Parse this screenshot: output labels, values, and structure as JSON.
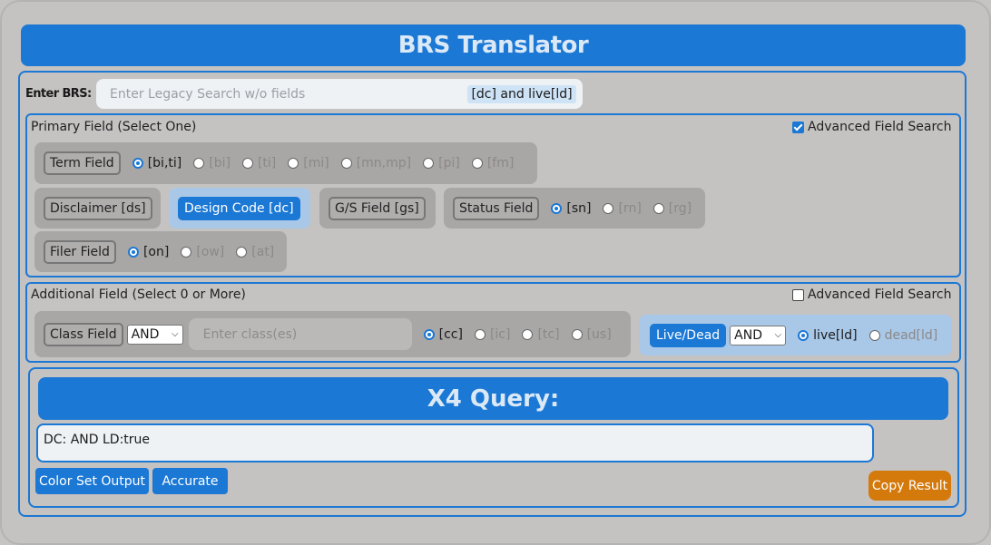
{
  "app": {
    "title": "BRS Translator"
  },
  "enter": {
    "label": "Enter BRS:",
    "placeholder": "Enter Legacy Search w/o fields",
    "value": "",
    "result": "[dc] and live[ld]"
  },
  "primary": {
    "title": "Primary Field (Select One)",
    "advanced_label": "Advanced Field Search",
    "advanced_checked": true,
    "term": {
      "label": "Term Field",
      "options": [
        "[bi,ti]",
        "[bi]",
        "[ti]",
        "[mi]",
        "[mn,mp]",
        "[pi]",
        "[fm]"
      ],
      "selected": "[bi,ti]"
    },
    "disclaimer": {
      "label": "Disclaimer [ds]"
    },
    "design_code": {
      "label": "Design Code [dc]",
      "active": true
    },
    "gs": {
      "label": "G/S Field [gs]"
    },
    "status": {
      "label": "Status Field",
      "options": [
        "[sn]",
        "[rn]",
        "[rg]"
      ],
      "selected": "[sn]"
    },
    "filer": {
      "label": "Filer Field",
      "options": [
        "[on]",
        "[ow]",
        "[at]"
      ],
      "selected": "[on]"
    }
  },
  "additional": {
    "title": "Additional Field (Select 0 or More)",
    "advanced_label": "Advanced Field Search",
    "advanced_checked": false,
    "class": {
      "label": "Class Field",
      "operator": "AND",
      "placeholder": "Enter class(es)",
      "options": [
        "[cc]",
        "[ic]",
        "[tc]",
        "[us]"
      ],
      "selected": "[cc]"
    },
    "live_dead": {
      "label": "Live/Dead",
      "operator": "AND",
      "options": [
        "live[ld]",
        "dead[ld]"
      ],
      "selected": "live[ld]"
    }
  },
  "x4": {
    "title": "X4 Query:",
    "output": "DC: AND LD:true",
    "color_set_label": "Color Set Output",
    "accurate_label": "Accurate",
    "copy_label": "Copy Result"
  },
  "colors": {
    "primary_blue": "#1b78d4",
    "copy_orange": "#d47a0c",
    "background": "#c5c2c2"
  }
}
